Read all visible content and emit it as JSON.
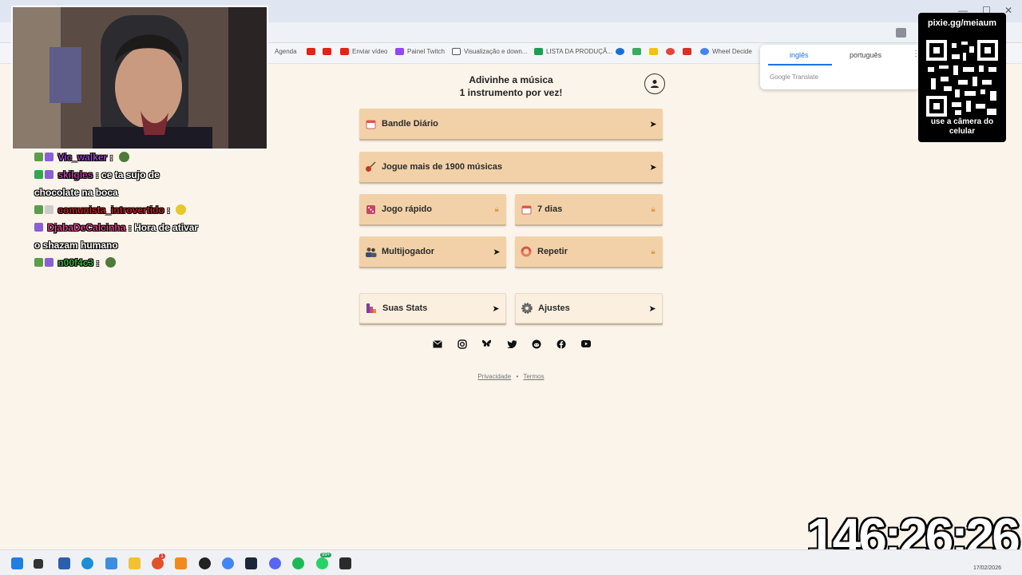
{
  "browser": {
    "bookmarks": [
      "Agenda",
      "Enviar vídeo",
      "Painel Twitch",
      "Visualização e down...",
      "LISTA DA PRODUÇÃ...",
      "Wheel Decide"
    ]
  },
  "translate": {
    "source_lang": "inglês",
    "target_lang": "português",
    "brand": "Google Translate"
  },
  "page": {
    "title_line1": "Adivinhe a música",
    "title_line2": "1 instrumento por vez!",
    "buttons": {
      "daily": "Bandle Diário",
      "play_all": "Jogue mais de 1900 músicas",
      "quick": "Jogo rápido",
      "seven_days": "7 dias",
      "multiplayer": "Multijogador",
      "repeat": "Repetir",
      "stats": "Suas Stats",
      "settings": "Ajustes"
    },
    "footer": {
      "privacy": "Privacidade",
      "separator": "•",
      "terms": "Termos"
    }
  },
  "chat": [
    {
      "user": "Vic_walker",
      "message": ""
    },
    {
      "user": "skilgles",
      "message": "ce ta sujo de"
    },
    {
      "user": "",
      "message": "chocolate na boca"
    },
    {
      "user": "comunista_introvertido",
      "message": ""
    },
    {
      "user": "DjabaDeCalcinha",
      "message": "Hora de ativar"
    },
    {
      "user": "",
      "message": "o shazam humano"
    },
    {
      "user": "n00f4c3",
      "message": ""
    }
  ],
  "overlay": {
    "qr_url": "pixie.gg/meiaum",
    "qr_caption_line1": "use a câmera do",
    "qr_caption_line2": "celular",
    "timer": "146:26:26"
  },
  "taskbar": {
    "date": "17/02/2026",
    "whatsapp_badge": "99+",
    "notif_badge": "1"
  }
}
